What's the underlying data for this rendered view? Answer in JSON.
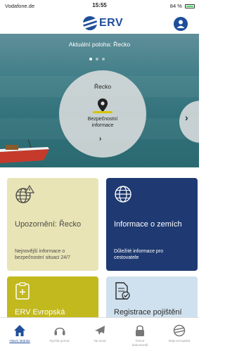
{
  "status_bar": {
    "carrier": "Vodafone.de",
    "time": "15:55",
    "battery": "84 %"
  },
  "header": {
    "logo_text": "ERV",
    "profile_icon": "person-icon"
  },
  "hero": {
    "current_location": "Aktuální poloha: Řecko",
    "carousel_pages": 3,
    "active_page": 1,
    "card": {
      "country": "Řecko",
      "info_line1": "Bezpečnostní",
      "info_line2": "informace",
      "icon": "location-pin-icon"
    },
    "next_card_icon": "chevron-right-icon"
  },
  "tiles": [
    {
      "title": "Upozornění: Řecko",
      "subtitle_line1": "Nejnovější informace o",
      "subtitle_line2": "bezpečnostní situaci 24/7",
      "icon": "globe-alert-icon",
      "color": "#e9e4b6"
    },
    {
      "title": "Informace o zemích",
      "subtitle_line1": "Důležité informace pro",
      "subtitle_line2": "cestovatele",
      "icon": "globe-icon",
      "color": "#1f3a72"
    },
    {
      "title": "ERV Evropská",
      "icon": "document-card-icon",
      "color": "#c2b91e"
    },
    {
      "title": "Registrace pojištění",
      "icon": "document-check-icon",
      "color": "#cfe1ee"
    }
  ],
  "tabbar": {
    "items": [
      {
        "label": "Hlavní stránka",
        "icon": "home-icon",
        "active": true
      },
      {
        "label": "Rychlá pomoc",
        "icon": "headset-icon",
        "active": false
      },
      {
        "label": "Na úvod",
        "icon": "airplane-icon",
        "active": false
      },
      {
        "label": "Trezor",
        "label2": "dokumentů",
        "icon": "lock-icon",
        "active": false
      },
      {
        "label": "Moje Evropská",
        "icon": "erv-logo-icon",
        "active": false
      }
    ]
  },
  "colors": {
    "brand_blue": "#1f4e9a",
    "pin_accent": "#d5c500"
  }
}
